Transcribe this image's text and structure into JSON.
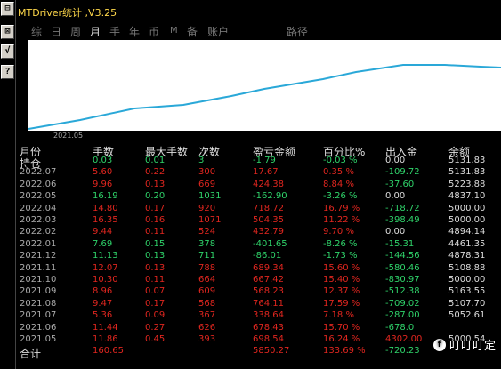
{
  "toolbar": {
    "buttons": [
      "⊟",
      "⊠",
      "√",
      "?"
    ]
  },
  "window": {
    "title": "MTDriver统计 ,V3.25"
  },
  "tabs": [
    {
      "label": "综"
    },
    {
      "label": "日"
    },
    {
      "label": "周"
    },
    {
      "label": "月",
      "active": true
    },
    {
      "label": "手"
    },
    {
      "label": "年"
    },
    {
      "label": "币"
    },
    {
      "label": "M"
    },
    {
      "label": "备"
    },
    {
      "label": "账户"
    },
    {
      "label": "路径"
    }
  ],
  "chart": {
    "x_label": "2021.05",
    "line_color": "#2aa8d8"
  },
  "table": {
    "headers": {
      "month": "月份",
      "lots": "手数",
      "max_lots": "最大手数",
      "count": "次数",
      "pl": "盈亏金额",
      "pct": "百分比%",
      "io": "出入金",
      "balance": "余额"
    },
    "rows": [
      {
        "month": "持仓",
        "lots": "0.03",
        "max_lots": "0.01",
        "count": "3",
        "pl": "-1.79",
        "pct": "-0.03 %",
        "io": "0.00",
        "balance": "5131.83",
        "color": "green",
        "io_color": "white"
      },
      {
        "month": "2022.07",
        "lots": "5.60",
        "max_lots": "0.22",
        "count": "300",
        "pl": "17.67",
        "pct": "0.35 %",
        "io": "-109.72",
        "balance": "5131.83",
        "color": "red",
        "io_color": "green"
      },
      {
        "month": "2022.06",
        "lots": "9.96",
        "max_lots": "0.13",
        "count": "669",
        "pl": "424.38",
        "pct": "8.84 %",
        "io": "-37.60",
        "balance": "5223.88",
        "color": "red",
        "io_color": "green"
      },
      {
        "month": "2022.05",
        "lots": "16.19",
        "max_lots": "0.20",
        "count": "1031",
        "pl": "-162.90",
        "pct": "-3.26 %",
        "io": "0.00",
        "balance": "4837.10",
        "color": "green",
        "io_color": "white"
      },
      {
        "month": "2022.04",
        "lots": "14.80",
        "max_lots": "0.17",
        "count": "920",
        "pl": "718.72",
        "pct": "16.79 %",
        "io": "-718.72",
        "balance": "5000.00",
        "color": "red",
        "io_color": "green"
      },
      {
        "month": "2022.03",
        "lots": "16.35",
        "max_lots": "0.16",
        "count": "1071",
        "pl": "504.35",
        "pct": "11.22 %",
        "io": "-398.49",
        "balance": "5000.00",
        "color": "red",
        "io_color": "green"
      },
      {
        "month": "2022.02",
        "lots": "9.44",
        "max_lots": "0.11",
        "count": "524",
        "pl": "432.79",
        "pct": "9.70 %",
        "io": "0.00",
        "balance": "4894.14",
        "color": "red",
        "io_color": "white"
      },
      {
        "month": "2022.01",
        "lots": "7.69",
        "max_lots": "0.15",
        "count": "378",
        "pl": "-401.65",
        "pct": "-8.26 %",
        "io": "-15.31",
        "balance": "4461.35",
        "color": "green",
        "io_color": "green"
      },
      {
        "month": "2021.12",
        "lots": "11.13",
        "max_lots": "0.13",
        "count": "711",
        "pl": "-86.01",
        "pct": "-1.73 %",
        "io": "-144.56",
        "balance": "4878.31",
        "color": "green",
        "io_color": "green"
      },
      {
        "month": "2021.11",
        "lots": "12.07",
        "max_lots": "0.13",
        "count": "788",
        "pl": "689.34",
        "pct": "15.60 %",
        "io": "-580.46",
        "balance": "5108.88",
        "color": "red",
        "io_color": "green"
      },
      {
        "month": "2021.10",
        "lots": "10.30",
        "max_lots": "0.11",
        "count": "664",
        "pl": "667.42",
        "pct": "15.40 %",
        "io": "-830.97",
        "balance": "5000.00",
        "color": "red",
        "io_color": "green"
      },
      {
        "month": "2021.09",
        "lots": "8.96",
        "max_lots": "0.07",
        "count": "609",
        "pl": "568.23",
        "pct": "12.37 %",
        "io": "-512.38",
        "balance": "5163.55",
        "color": "red",
        "io_color": "green"
      },
      {
        "month": "2021.08",
        "lots": "9.47",
        "max_lots": "0.17",
        "count": "568",
        "pl": "764.11",
        "pct": "17.59 %",
        "io": "-709.02",
        "balance": "5107.70",
        "color": "red",
        "io_color": "green"
      },
      {
        "month": "2021.07",
        "lots": "5.36",
        "max_lots": "0.09",
        "count": "367",
        "pl": "338.64",
        "pct": "7.18 %",
        "io": "-287.00",
        "balance": "5052.61",
        "color": "red",
        "io_color": "green"
      },
      {
        "month": "2021.06",
        "lots": "11.44",
        "max_lots": "0.27",
        "count": "626",
        "pl": "678.43",
        "pct": "15.70 %",
        "io": "-678.0",
        "balance": "",
        "color": "red",
        "io_color": "green"
      },
      {
        "month": "2021.05",
        "lots": "11.86",
        "max_lots": "0.45",
        "count": "393",
        "pl": "698.54",
        "pct": "16.24 %",
        "io": "4302.00",
        "balance": "5000.54",
        "color": "red",
        "io_color": "red"
      },
      {
        "month": "合计",
        "lots": "160.65",
        "max_lots": "",
        "count": "",
        "pl": "5850.27",
        "pct": "133.69 %",
        "io": "-720.23",
        "balance": "",
        "color": "red",
        "io_color": "green"
      }
    ]
  },
  "watermark": {
    "icon": "f",
    "text": "叮叮叮定"
  }
}
